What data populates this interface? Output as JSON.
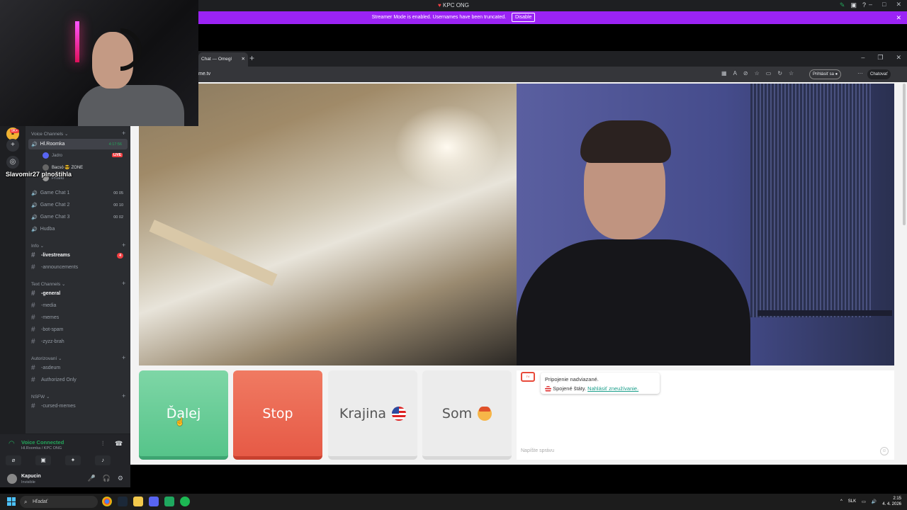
{
  "discord": {
    "window_title": "KPC ONG",
    "streamer_notice": "Streamer Mode is enabled. Usernames have been truncated.",
    "streamer_disable": "Disable",
    "server_badge": "9K+",
    "categories": {
      "voice": "Voice Channels",
      "info": "Info",
      "text": "Text Channels",
      "autorizovani": "Autorizovaní",
      "nsfw": "NSFW"
    },
    "voice_channels": [
      {
        "name": "Hl.Roomka",
        "timer": "4:17:56"
      },
      {
        "name": "Game Chat 1",
        "count": "00 05"
      },
      {
        "name": "Game Chat 2",
        "count": "00 10"
      },
      {
        "name": "Game Chat 3",
        "count": "00 02"
      },
      {
        "name": "Hudba"
      }
    ],
    "voice_users": [
      {
        "name": "Jadro",
        "live": "LIVE"
      },
      {
        "name": "Bacsó 😎 ZONE"
      },
      {
        "name": "Přítelo"
      }
    ],
    "overlay_name": "Slavomir27  plnoštihla",
    "info_channels": [
      {
        "name": "-livestreams",
        "badge": "4"
      },
      {
        "name": "-announcements"
      }
    ],
    "text_channels": [
      {
        "name": "-general"
      },
      {
        "name": "-media"
      },
      {
        "name": "-memes"
      },
      {
        "name": "-bot-spam"
      },
      {
        "name": "-zyzz-brah"
      }
    ],
    "auth_channels": [
      {
        "name": "-asdeum"
      },
      {
        "name": "Authorized Only"
      }
    ],
    "nsfw_channels": [
      {
        "name": "-cursed-memes"
      }
    ],
    "voice_status": {
      "title": "Voice Connected",
      "subtitle": "Hl.Roomka / KPC ONG"
    },
    "user": {
      "name": "Kapucin",
      "status": "Invisible"
    }
  },
  "browser": {
    "tab_title": "Chat — Omegl",
    "url": "me.tv",
    "login": "Prihlásiť sa",
    "chat_button": "Chatovať"
  },
  "omegle": {
    "buttons": {
      "next": "Ďalej",
      "stop": "Stop",
      "country": "Krajina",
      "me": "Som"
    },
    "system_message": {
      "line1": "Pripojenie nadviazané.",
      "country": "Spojené štáty.",
      "report": "Nahlásiť zneužívanie."
    },
    "input_placeholder": "Napíšte správu"
  },
  "taskbar": {
    "search": "Hľadať",
    "lang": "SLK",
    "time": "2:15",
    "date": "4. 4. 2026"
  }
}
